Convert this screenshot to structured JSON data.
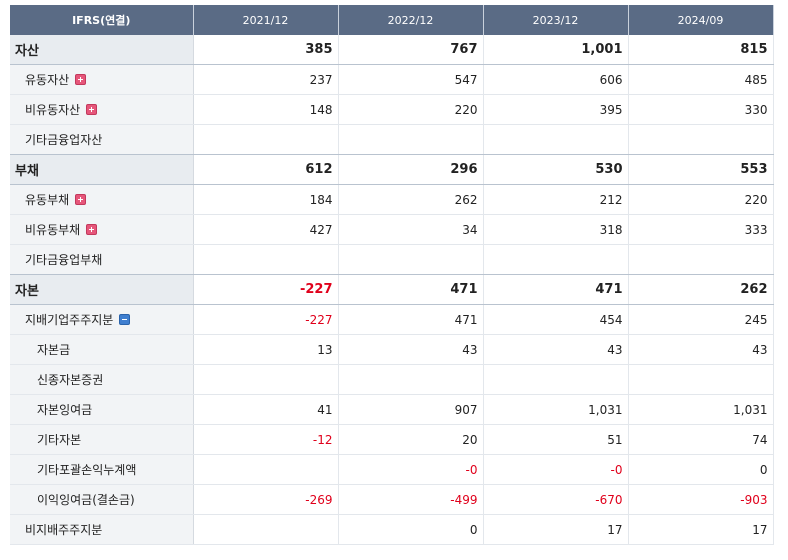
{
  "header": [
    "IFRS(연결)",
    "2021/12",
    "2022/12",
    "2023/12",
    "2024/09"
  ],
  "rows": [
    {
      "label": "자산",
      "level": 0,
      "values": [
        "385",
        "767",
        "1,001",
        "815"
      ]
    },
    {
      "label": "유동자산",
      "level": 1,
      "toggle": "plus",
      "values": [
        "237",
        "547",
        "606",
        "485"
      ]
    },
    {
      "label": "비유동자산",
      "level": 1,
      "toggle": "plus",
      "values": [
        "148",
        "220",
        "395",
        "330"
      ]
    },
    {
      "label": "기타금융업자산",
      "level": 1,
      "values": [
        "",
        "",
        "",
        ""
      ]
    },
    {
      "label": "부채",
      "level": 0,
      "values": [
        "612",
        "296",
        "530",
        "553"
      ]
    },
    {
      "label": "유동부채",
      "level": 1,
      "toggle": "plus",
      "values": [
        "184",
        "262",
        "212",
        "220"
      ]
    },
    {
      "label": "비유동부채",
      "level": 1,
      "toggle": "plus",
      "values": [
        "427",
        "34",
        "318",
        "333"
      ]
    },
    {
      "label": "기타금융업부채",
      "level": 1,
      "values": [
        "",
        "",
        "",
        ""
      ]
    },
    {
      "label": "자본",
      "level": 0,
      "values": [
        "-227",
        "471",
        "471",
        "262"
      ]
    },
    {
      "label": "지배기업주주지분",
      "level": 1,
      "toggle": "minus",
      "values": [
        "-227",
        "471",
        "454",
        "245"
      ]
    },
    {
      "label": "자본금",
      "level": 2,
      "values": [
        "13",
        "43",
        "43",
        "43"
      ]
    },
    {
      "label": "신종자본증권",
      "level": 2,
      "values": [
        "",
        "",
        "",
        ""
      ]
    },
    {
      "label": "자본잉여금",
      "level": 2,
      "values": [
        "41",
        "907",
        "1,031",
        "1,031"
      ]
    },
    {
      "label": "기타자본",
      "level": 2,
      "values": [
        "-12",
        "20",
        "51",
        "74"
      ]
    },
    {
      "label": "기타포괄손익누계액",
      "level": 2,
      "values": [
        "",
        "-0",
        "-0",
        "0"
      ]
    },
    {
      "label": "이익잉여금(결손금)",
      "level": 2,
      "values": [
        "-269",
        "-499",
        "-670",
        "-903"
      ]
    },
    {
      "label": "비지배주주지분",
      "level": 1,
      "values": [
        "",
        "0",
        "17",
        "17"
      ]
    }
  ],
  "colors": {
    "header_bg": "#5a6b85",
    "negative": "#e0001b",
    "label_bg": "#f2f4f6"
  }
}
